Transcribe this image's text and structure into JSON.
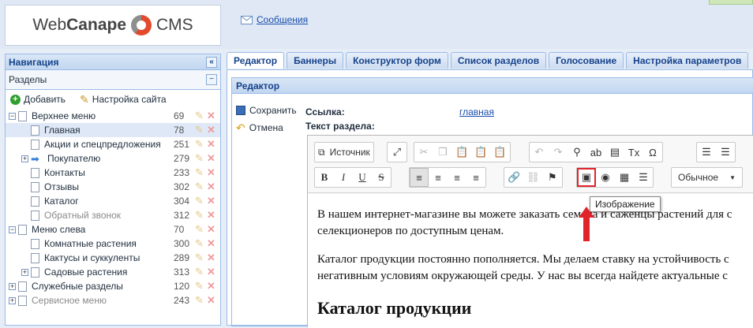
{
  "app": {
    "logo_text_a": "Web",
    "logo_text_b": "Canape",
    "logo_text_c": "CMS"
  },
  "header": {
    "messages_label": "Сообщения"
  },
  "nav": {
    "title": "Навигация",
    "collapse_glyph": "«",
    "section_title": "Разделы",
    "section_toggle": "−",
    "add_label": "Добавить",
    "settings_label": "Настройка сайта",
    "items": [
      {
        "label": "Верхнее меню",
        "count": "69",
        "level": 0,
        "expander": "−",
        "icon": "folder-icon"
      },
      {
        "label": "Главная",
        "count": "78",
        "level": 1,
        "expander": "",
        "icon": "page-icon",
        "selected": true
      },
      {
        "label": "Акции и спецпредложения",
        "count": "251",
        "level": 1,
        "expander": "",
        "icon": "page-icon"
      },
      {
        "label": "Покупателю",
        "count": "279",
        "level": 1,
        "expander": "+",
        "icon": "redirect-arrow-icon"
      },
      {
        "label": "Контакты",
        "count": "233",
        "level": 1,
        "expander": "",
        "icon": "page-icon"
      },
      {
        "label": "Отзывы",
        "count": "302",
        "level": 1,
        "expander": "",
        "icon": "page-icon"
      },
      {
        "label": "Каталог",
        "count": "304",
        "level": 1,
        "expander": "",
        "icon": "page-icon"
      },
      {
        "label": "Обратный звонок",
        "count": "312",
        "level": 1,
        "expander": "",
        "icon": "page-icon",
        "dim": true
      },
      {
        "label": "Меню слева",
        "count": "70",
        "level": 0,
        "expander": "−",
        "icon": "folder-icon"
      },
      {
        "label": "Комнатные растения",
        "count": "300",
        "level": 1,
        "expander": "",
        "icon": "page-icon"
      },
      {
        "label": "Кактусы и суккуленты",
        "count": "289",
        "level": 1,
        "expander": "",
        "icon": "page-icon"
      },
      {
        "label": "Садовые растения",
        "count": "313",
        "level": 1,
        "expander": "+",
        "icon": "page-icon"
      },
      {
        "label": "Служебные разделы",
        "count": "120",
        "level": 0,
        "expander": "+",
        "icon": "folder-icon"
      },
      {
        "label": "Сервисное меню",
        "count": "243",
        "level": 0,
        "expander": "+",
        "icon": "folder-icon",
        "dim": true
      }
    ]
  },
  "tabs": [
    "Редактор",
    "Баннеры",
    "Конструктор форм",
    "Список разделов",
    "Голосование",
    "Настройка параметров"
  ],
  "active_tab": 0,
  "editor": {
    "panel_title": "Редактор",
    "save_label": "Сохранить",
    "cancel_label": "Отмена",
    "link_label": "Ссылка:",
    "link_value": "главная",
    "text_label": "Текст раздела:",
    "source_label": "Источник",
    "format_label": "Обычное",
    "tooltip": "Изображение",
    "content": {
      "p1_line1": "В нашем интернет-магазине вы можете заказать семена и саженцы растений для с",
      "p1_line2": "селекционеров по доступным ценам.",
      "p2_line1": "Каталог продукции постоянно пополняется. Мы делаем ставку на устойчивость с",
      "p2_line2": "негативным условиям окружающей среды. У нас вы всегда найдете актуальные с",
      "heading": "Каталог продукции"
    }
  },
  "colors": {
    "accent": "#15428b",
    "highlight": "#e0242a",
    "link": "#1a4fae"
  }
}
